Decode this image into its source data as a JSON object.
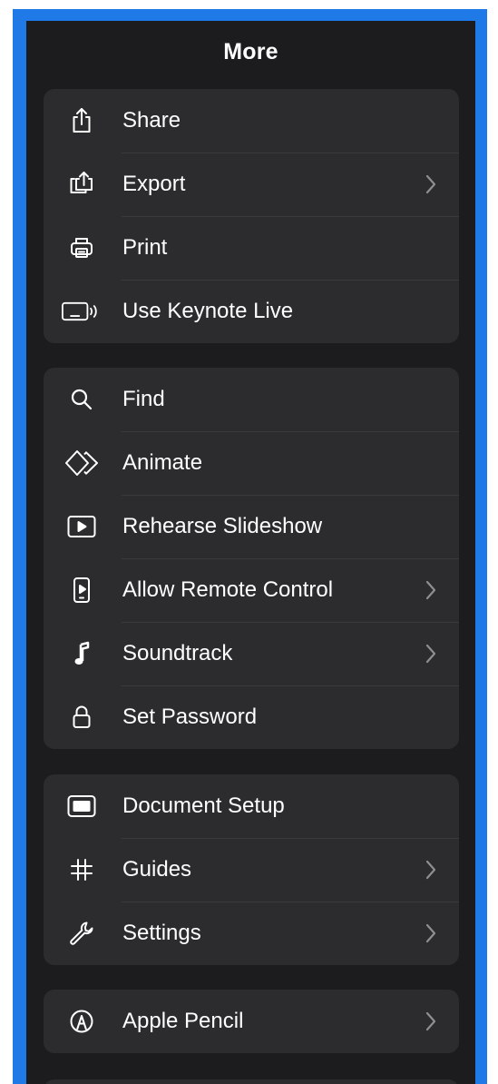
{
  "header": {
    "title": "More"
  },
  "groups": [
    {
      "items": [
        {
          "label": "Share",
          "icon": "share-icon",
          "chevron": false
        },
        {
          "label": "Export",
          "icon": "export-icon",
          "chevron": true
        },
        {
          "label": "Print",
          "icon": "print-icon",
          "chevron": false
        },
        {
          "label": "Use Keynote Live",
          "icon": "keynote-live-icon",
          "chevron": false
        }
      ]
    },
    {
      "items": [
        {
          "label": "Find",
          "icon": "search-icon",
          "chevron": false
        },
        {
          "label": "Animate",
          "icon": "animate-icon",
          "chevron": false
        },
        {
          "label": "Rehearse Slideshow",
          "icon": "play-icon",
          "chevron": false
        },
        {
          "label": "Allow Remote Control",
          "icon": "remote-control-icon",
          "chevron": true
        },
        {
          "label": "Soundtrack",
          "icon": "music-note-icon",
          "chevron": true
        },
        {
          "label": "Set Password",
          "icon": "lock-icon",
          "chevron": false
        }
      ]
    },
    {
      "items": [
        {
          "label": "Document Setup",
          "icon": "document-setup-icon",
          "chevron": false
        },
        {
          "label": "Guides",
          "icon": "hash-icon",
          "chevron": true
        },
        {
          "label": "Settings",
          "icon": "wrench-icon",
          "chevron": true
        }
      ]
    },
    {
      "items": [
        {
          "label": "Apple Pencil",
          "icon": "pencil-icon",
          "chevron": true
        }
      ]
    }
  ],
  "colors": {
    "frame_border": "#1f7ae8",
    "panel_background": "#1c1c1e",
    "row_background": "#2c2c2e",
    "separator": "#3a3a3c",
    "text": "#ffffff",
    "chevron": "#8e8e93"
  }
}
